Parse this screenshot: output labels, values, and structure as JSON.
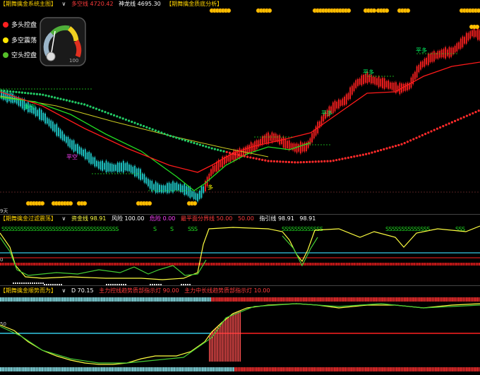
{
  "main_panel": {
    "header": [
      {
        "text": "【期舞擒金系统主图】",
        "color": "#ffd400"
      },
      {
        "text": "∨",
        "color": "#ffffff"
      },
      {
        "text": "多空线 4720.42",
        "color": "#ff3b3b"
      },
      {
        "text": "神龙线 4695.30",
        "color": "#ffffff"
      },
      {
        "text": "【期舞擒金质底分析】",
        "color": "#ffd400"
      }
    ],
    "legend": [
      {
        "label": "多头控盘",
        "color": "#ff2020"
      },
      {
        "label": "多空震荡",
        "color": "#ffe600"
      },
      {
        "label": "空头控盘",
        "color": "#55c02a"
      }
    ],
    "gauge_value": "100",
    "gauge_level": 0.95,
    "labels": [
      {
        "text": "多空",
        "color": "#00ff66"
      },
      {
        "text": "平空",
        "color": "#ff40ff"
      },
      {
        "text": "多",
        "color": "#ffff00"
      },
      {
        "text": "平多",
        "color": "#00ff66"
      },
      {
        "text": "平多",
        "color": "#00ff66"
      },
      {
        "text": "平多",
        "color": "#00ff66"
      }
    ],
    "y_tick": "9天"
  },
  "panel2": {
    "header": [
      {
        "text": "【期舞擒金过滤震荡】",
        "color": "#ffd400"
      },
      {
        "text": "∨",
        "color": "#ffffff"
      },
      {
        "text": "资金线 98.91",
        "color": "#ffff40"
      },
      {
        "text": "风险 100.00",
        "color": "#ffffff"
      },
      {
        "text": "危险 0.00",
        "color": "#ff40ff"
      },
      {
        "text": "最平面分界线 50.00",
        "color": "#ff3b3b"
      },
      {
        "text": "50.00",
        "color": "#ff3b3b"
      },
      {
        "text": "指引线 98.91",
        "color": "#ffffff"
      },
      {
        "text": "98.91",
        "color": "#ffffff"
      }
    ],
    "s_markers": [
      {
        "text": "SSSSSSSSSSSSSSSSSSSSSSSSSSSSSSSSSSSSS"
      },
      {
        "text": "S"
      },
      {
        "text": "S"
      },
      {
        "text": "SSS"
      },
      {
        "text": "SSSSSSSSSSSSS"
      },
      {
        "text": "SSSSSSSSSSSSSS"
      },
      {
        "text": "SSS"
      }
    ],
    "y_tick": "0"
  },
  "panel3": {
    "header": [
      {
        "text": "【期舞擒金顺势而为】",
        "color": "#ffd400"
      },
      {
        "text": "∨",
        "color": "#ffffff"
      },
      {
        "text": "D 70.15",
        "color": "#ffffff"
      },
      {
        "text": "主力控线趋势质部指示灯 90.00",
        "color": "#ff3b3b"
      },
      {
        "text": "主力中长线趋势质部指示灯 10.00",
        "color": "#ff3b3b"
      }
    ],
    "y_tick": "50"
  },
  "colors": {
    "up_candle": "#ff2020",
    "down_candle": "#20d0d0",
    "ma_red": "#ff1a1a",
    "ma_green": "#22dd22",
    "ma_yellow": "#c8c820",
    "cyan_line": "#33c8e6",
    "coin": "#ffc000"
  }
}
